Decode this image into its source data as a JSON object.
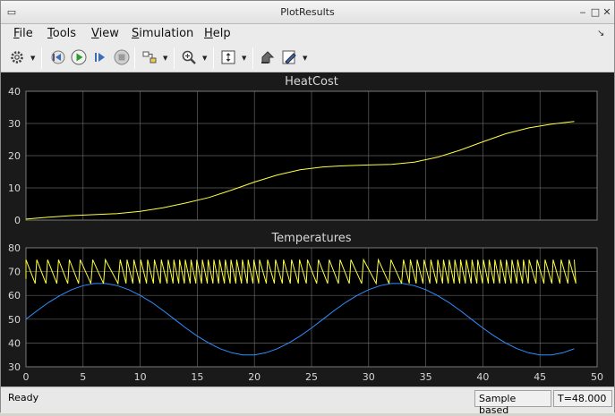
{
  "window": {
    "title": "PlotResults"
  },
  "menu": {
    "items": [
      {
        "id": "file",
        "key": "F",
        "rest": "ile"
      },
      {
        "id": "tools",
        "key": "T",
        "rest": "ools"
      },
      {
        "id": "view",
        "key": "V",
        "rest": "iew"
      },
      {
        "id": "simulation",
        "key": "S",
        "rest": "imulation"
      },
      {
        "id": "help",
        "key": "H",
        "rest": "elp"
      }
    ]
  },
  "toolbar": {
    "icons": [
      "gear-icon",
      "step-back-icon",
      "run-icon",
      "step-forward-icon",
      "stop-icon",
      "highlight-icon",
      "zoom-icon",
      "autoscale-icon",
      "scope-icon",
      "style-icon"
    ],
    "colors": {
      "run": "#2a9d2a",
      "stop": "#9a9a9a"
    }
  },
  "plots": {
    "background": "#000000",
    "grid_color": "#7a7a7a",
    "label_color": "#d8d8d8"
  },
  "chart_data": [
    {
      "type": "line",
      "title": "HeatCost",
      "xlim": [
        0,
        48
      ],
      "ylim": [
        0,
        40
      ],
      "yticks": [
        "0",
        "10",
        "20",
        "30",
        "40"
      ],
      "grid": true,
      "series": [
        {
          "color": "#ffff40",
          "x": [
            0,
            2,
            4,
            6,
            8,
            10,
            12,
            14,
            16,
            18,
            20,
            22,
            24,
            26,
            28,
            30,
            32,
            34,
            36,
            38,
            40,
            42,
            44,
            46,
            48
          ],
          "y": [
            0.3,
            0.9,
            1.4,
            1.7,
            2.0,
            2.7,
            3.8,
            5.3,
            7.0,
            9.3,
            11.8,
            14.0,
            15.6,
            16.5,
            16.9,
            17.1,
            17.3,
            18.0,
            19.5,
            21.7,
            24.3,
            26.8,
            28.6,
            29.8,
            30.6
          ]
        }
      ]
    },
    {
      "type": "line",
      "title": "Temperatures",
      "xlim": [
        0,
        48
      ],
      "ylim": [
        30,
        80
      ],
      "yticks": [
        "30",
        "40",
        "50",
        "60",
        "70",
        "80"
      ],
      "xticks": [
        "0",
        "5",
        "10",
        "15",
        "20",
        "25",
        "30",
        "35",
        "40",
        "45",
        "50"
      ],
      "grid": true,
      "series": [
        {
          "color": "#2f8fff",
          "x": [
            0,
            1,
            2,
            3,
            4,
            5,
            6,
            7,
            8,
            9,
            10,
            11,
            12,
            13,
            14,
            15,
            16,
            17,
            18,
            19,
            20,
            21,
            22,
            23,
            24,
            25,
            26,
            27,
            28,
            29,
            30,
            31,
            32,
            33,
            34,
            35,
            36,
            37,
            38,
            39,
            40,
            41,
            42,
            43,
            44,
            45,
            46,
            47,
            48
          ],
          "y": [
            50,
            53.7,
            57.1,
            60.0,
            62.4,
            64.1,
            65.0,
            65.0,
            64.1,
            62.4,
            60.0,
            57.1,
            53.7,
            50.0,
            46.3,
            42.9,
            40.0,
            37.6,
            35.9,
            35.0,
            35.0,
            35.9,
            37.6,
            40.0,
            42.9,
            46.3,
            50.0,
            53.7,
            57.1,
            60.0,
            62.4,
            64.1,
            65.0,
            65.0,
            64.1,
            62.4,
            60.0,
            57.1,
            53.7,
            50.0,
            46.3,
            42.9,
            40.0,
            37.6,
            35.9,
            35.0,
            35.0,
            35.9,
            37.6
          ]
        },
        {
          "color": "#ffff40",
          "range": [
            65,
            75
          ],
          "period_profile": "fast sawtooth oscillation between 65 and 75",
          "x": [
            0,
            48
          ],
          "y": [
            65,
            75
          ]
        }
      ]
    }
  ],
  "status": {
    "ready": "Ready",
    "mode": "Sample based",
    "time": "T=48.000"
  }
}
